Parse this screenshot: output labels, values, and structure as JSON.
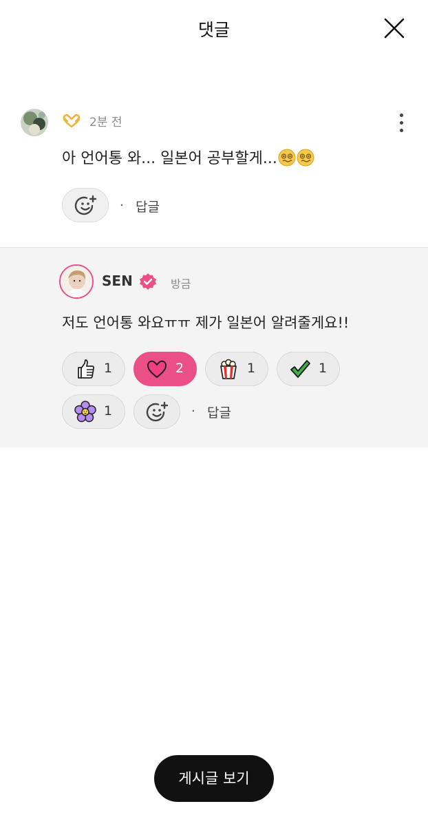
{
  "header": {
    "title": "댓글"
  },
  "comment": {
    "time": "2분 전",
    "text": "아 언어통 와... 일본어 공부할게...",
    "reply_label": "답글",
    "separator": "·"
  },
  "reply": {
    "author": "SEN",
    "time": "방금",
    "text": "저도 언어통 와요ㅠㅠ 제가 일본어 알려줄게요!!",
    "reply_label": "답글",
    "separator": "·",
    "reactions": [
      {
        "emoji": "thumbs-up",
        "count": "1",
        "active": false
      },
      {
        "emoji": "heart",
        "count": "2",
        "active": true
      },
      {
        "emoji": "popcorn",
        "count": "1",
        "active": false
      },
      {
        "emoji": "check",
        "count": "1",
        "active": false
      },
      {
        "emoji": "flower",
        "count": "1",
        "active": false
      }
    ]
  },
  "footer": {
    "view_post_label": "게시글 보기"
  },
  "colors": {
    "accent_pink": "#ea4f86",
    "chip_bg": "#ececec",
    "reply_bg": "#f4f4f4",
    "button_dark": "#111111"
  }
}
